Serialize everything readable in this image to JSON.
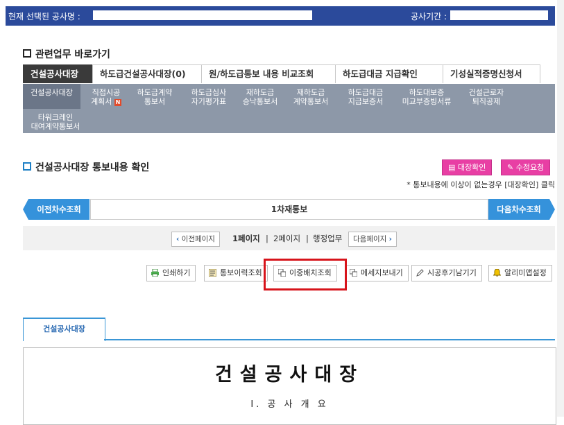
{
  "header": {
    "current_project_label": "현재 선택된 공사명 :",
    "period_label": "공사기간 :"
  },
  "related": {
    "title": "관련업무 바로가기",
    "tabs": [
      "건설공사대장",
      "하도급건설공사대장(0)",
      "원/하도급통보 내용 비교조회",
      "하도급대금 지급확인",
      "기성실적증명신청서"
    ],
    "subitems": [
      [
        "건설공사대장"
      ],
      [
        "직접시공",
        "계획서"
      ],
      [
        "하도급계약",
        "통보서"
      ],
      [
        "하도급심사",
        "자기평가표"
      ],
      [
        "재하도급",
        "승낙통보서"
      ],
      [
        "재하도급",
        "계약통보서"
      ],
      [
        "하도급대금",
        "지급보증서"
      ],
      [
        "하도대보증",
        "미교부증빙서류"
      ],
      [
        "건설근로자",
        "퇴직공제"
      ],
      [
        "타워크레인",
        "대여계약통보서"
      ]
    ],
    "new_badge": "N"
  },
  "check": {
    "title": "건설공사대장 통보내용 확인",
    "confirm_btn": "대장확인",
    "edit_btn": "수정요청",
    "notice": "* 통보내용에 이상이 없는경우 [대장확인] 클릭"
  },
  "revision": {
    "prev": "이전차수조회",
    "current": "1차재통보",
    "next": "다음차수조회"
  },
  "paging": {
    "prev": "이전페이지",
    "page1": "1페이지",
    "page2": "2페이지",
    "admin": "행정업무",
    "next": "다음페이지"
  },
  "toolbar": {
    "print": "인쇄하기",
    "history": "통보이력조회",
    "duplicate": "이중배치조회",
    "message": "메세지보내기",
    "review": "시공후기남기기",
    "alarm": "알리미앱설정"
  },
  "document": {
    "tab": "건설공사대장",
    "title": "건설공사대장",
    "section": "I. 공 사 개 요"
  },
  "colors": {
    "header_bg": "#2b4a9b",
    "accent_blue": "#3592db",
    "pink": "#e83fa4",
    "highlight": "#d7141b"
  }
}
